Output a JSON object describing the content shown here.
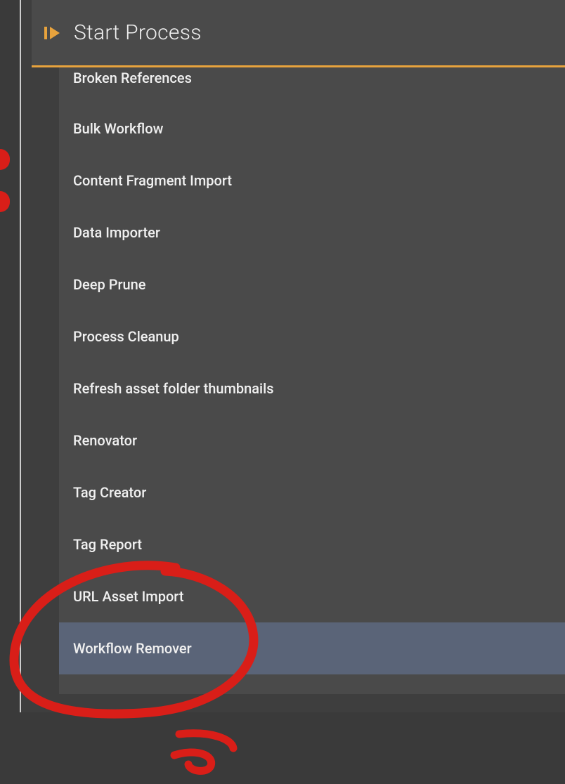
{
  "header": {
    "title": "Start Process"
  },
  "processes": [
    {
      "label": "Broken References",
      "selected": false,
      "truncated": true
    },
    {
      "label": "Bulk Workflow",
      "selected": false
    },
    {
      "label": "Content Fragment Import",
      "selected": false
    },
    {
      "label": "Data Importer",
      "selected": false
    },
    {
      "label": "Deep Prune",
      "selected": false
    },
    {
      "label": "Process Cleanup",
      "selected": false
    },
    {
      "label": "Refresh asset folder thumbnails",
      "selected": false
    },
    {
      "label": "Renovator",
      "selected": false
    },
    {
      "label": "Tag Creator",
      "selected": false
    },
    {
      "label": "Tag Report",
      "selected": false
    },
    {
      "label": "URL Asset Import",
      "selected": false
    },
    {
      "label": "Workflow Remover",
      "selected": true
    }
  ],
  "colors": {
    "accent": "#e8a33d",
    "panel": "#4a4a4a",
    "selected": "#5a6478",
    "annotation": "#d91e18"
  }
}
